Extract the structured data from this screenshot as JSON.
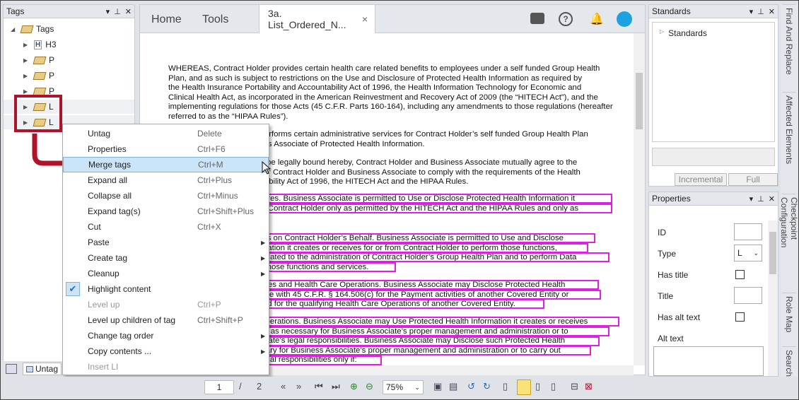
{
  "tags_panel": {
    "title": "Tags",
    "root": "Tags",
    "nodes": [
      "H3",
      "P",
      "P",
      "P",
      "L",
      "L"
    ],
    "bottom_tab": "Untag"
  },
  "doc": {
    "nav_home": "Home",
    "nav_tools": "Tools",
    "tab_title": "3a. List_Ordered_N...",
    "close": "×",
    "para1": [
      "WHEREAS, Contract Holder provides certain health care related benefits to employees under a self funded Group Health",
      "Plan, and as such is subject to restrictions on the Use and Disclosure of Protected Health Information as required by",
      "the Health Insurance Portability and Accountability Act of 1996, the Health Information Technology for Economic and",
      "Clinical Health Act, as incorporated in the American Reinvestment and Recovery Act of 2009 (the “HITECH Act”), and the",
      "implementing regulations for those Acts (45 C.F.R. Parts 160-164), including any amendments to those regulations (hereafter",
      "referred to as the “HIPAA Rules”)."
    ],
    "para2": [
      "iate performs certain administrative services for Contract Holder’s self funded Group Health Plan",
      "usiness Associate of Protected Health Information."
    ],
    "para3": [
      "ing to be legally bound hereby, Contract Holder and Business Associate mutually agree to the",
      "rder for Contract Holder and Business Associate to comply with the requirements of the Health",
      "countability Act of 1996, the HITECH Act and the HIPAA Rules."
    ],
    "para4": [
      "sclosures. Business Associate is permitted to Use or Disclose Protected Health Information it",
      "r from Contract Holder only as permitted by the HITECH Act and the HIPAA Rules and only as"
    ],
    "para5": [
      "ctivities on Contract Holder’s Behalf. Business Associate is permitted to Use and Disclose",
      "Information it creates or receives for or from Contract Holder to perform those functions,",
      "ices related to the administration of Contract Holder’s Group Health Plan and to perform Data",
      "ed to those functions and services."
    ],
    "para6": [
      "Activities and Health Care Operations. Business Associate may Disclose Protected Health",
      "ordance with 45 C.F.R. § 164.506(c) for the Payment activities of another Covered Entity or",
      "der and for the qualifying Health Care Operations of another Covered Entity."
    ],
    "para7": [
      "te’s Operations. Business Associate may Use Protected Health Information it creates or receives",
      "Holder as necessary for Business Associate’s proper management and administration or to",
      "Associate’s legal responsibilities. Business Associate may Disclose such Protected Health",
      "ecessary for Business Associate’s proper management and administration or to carry out",
      "te’s legal responsibilities only if:"
    ]
  },
  "menu": [
    {
      "label": "Untag",
      "shortcut": "Delete"
    },
    {
      "label": "Properties",
      "shortcut": "Ctrl+F6"
    },
    {
      "label": "Merge tags",
      "shortcut": "Ctrl+M",
      "selected": true
    },
    {
      "label": "Expand all",
      "shortcut": "Ctrl+Plus"
    },
    {
      "label": "Collapse all",
      "shortcut": "Ctrl+Minus"
    },
    {
      "label": "Expand tag(s)",
      "shortcut": "Ctrl+Shift+Plus"
    },
    {
      "label": "Cut",
      "shortcut": "Ctrl+X"
    },
    {
      "label": "Paste",
      "shortcut": "",
      "submenu": true
    },
    {
      "label": "Create tag",
      "shortcut": "",
      "submenu": true
    },
    {
      "label": "Cleanup",
      "shortcut": "",
      "submenu": true
    },
    {
      "label": "Highlight content",
      "shortcut": "",
      "checked": true
    },
    {
      "label": "Level up",
      "shortcut": "Ctrl+P",
      "disabled": true
    },
    {
      "label": "Level up children of tag",
      "shortcut": "Ctrl+Shift+P"
    },
    {
      "label": "Change tag order",
      "shortcut": "",
      "submenu": true
    },
    {
      "label": "Copy contents ...",
      "shortcut": "",
      "submenu": true
    },
    {
      "label": "Insert LI",
      "shortcut": "",
      "disabled": true
    }
  ],
  "standards": {
    "title": "Standards",
    "root": "Standards",
    "incremental": "Incremental",
    "full": "Full"
  },
  "properties": {
    "title": "Properties",
    "id": "ID",
    "type": "Type",
    "type_value": "L",
    "has_title": "Has title",
    "title_field": "Title",
    "has_alt": "Has alt text",
    "alt": "Alt text"
  },
  "vtabs": [
    "Find And Replace",
    "Affected Elements",
    "Checkpoint Configuration",
    "Role Map",
    "Search"
  ],
  "toolbar": {
    "page": "1",
    "sep": "/",
    "total": "2",
    "zoom": "75%"
  },
  "colors": {
    "highlight": "#e020e0",
    "callout": "#b0122a",
    "accent": "#1b6fd0"
  }
}
